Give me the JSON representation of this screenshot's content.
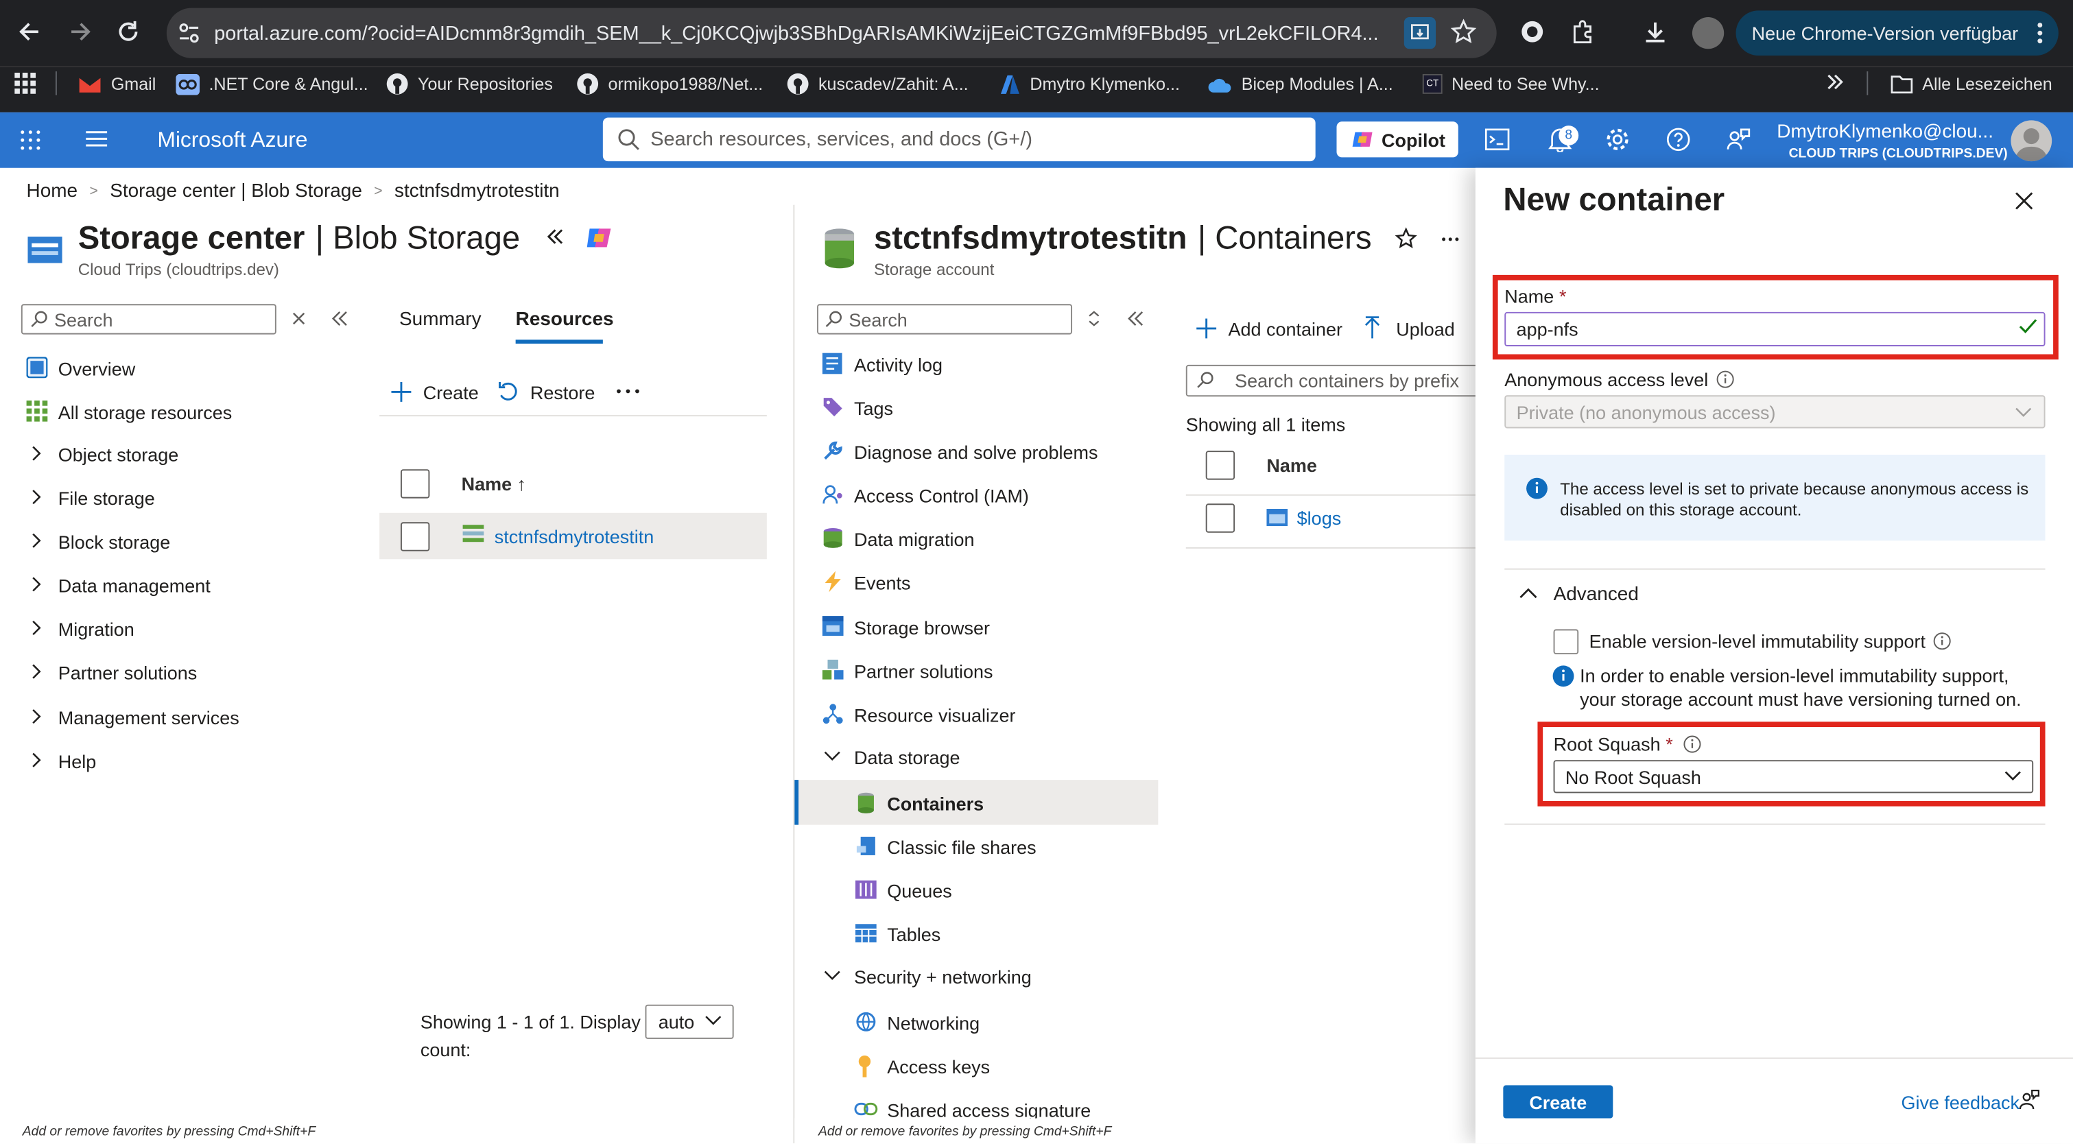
{
  "browser": {
    "url": "portal.azure.com/?ocid=AIDcmm8r3gmdih_SEM__k_Cj0KCQjwjb3SBhDgARIsAMKiWzijEeiCTGZGmMf9FBbd95_vrL2ekCFILOR4...",
    "update_label": "Neue Chrome-Version verfügbar",
    "bookmarks": [
      "Gmail",
      ".NET Core & Angul...",
      "Your Repositories",
      "ormikopo1988/Net...",
      "kuscadev/Zahit: A...",
      "Dmytro Klymenko...",
      "Bicep Modules | A...",
      "Need to See Why..."
    ],
    "all_bookmarks": "Alle Lesezeichen"
  },
  "azure": {
    "brand": "Microsoft Azure",
    "search_placeholder": "Search resources, services, and docs (G+/)",
    "copilot": "Copilot",
    "notification_count": "8",
    "user": "DmytroKlymenko@clou...",
    "tenant": "CLOUD TRIPS (CLOUDTRIPS.DEV)"
  },
  "breadcrumb": [
    "Home",
    "Storage center | Blob Storage",
    "stctnfsdmytrotestitn"
  ],
  "storage_center": {
    "title": "Storage center",
    "title_suffix": "| Blob Storage",
    "subtitle": "Cloud Trips (cloudtrips.dev)",
    "search_placeholder": "Search",
    "nav": [
      "Overview",
      "All storage resources",
      "Object storage",
      "File storage",
      "Block storage",
      "Data management",
      "Migration",
      "Partner solutions",
      "Management services",
      "Help"
    ],
    "favorites_hint": "Add or remove favorites by pressing Cmd+Shift+F"
  },
  "resources": {
    "tabs": [
      "Summary",
      "Resources"
    ],
    "active_tab": "Resources",
    "create": "Create",
    "restore": "Restore",
    "column_name": "Name ↑",
    "rows": [
      "stctnfsdmytrotestitn"
    ],
    "showing": "Showing 1 - 1 of 1. Display",
    "count_label": "count:",
    "display_value": "auto"
  },
  "account": {
    "title": "stctnfsdmytrotestitn",
    "title_suffix": "| Containers",
    "subtitle": "Storage account",
    "search_placeholder": "Search",
    "menu": [
      "Activity log",
      "Tags",
      "Diagnose and solve problems",
      "Access Control (IAM)",
      "Data migration",
      "Events",
      "Storage browser",
      "Partner solutions",
      "Resource visualizer"
    ],
    "data_storage_group": "Data storage",
    "data_storage_items": [
      "Containers",
      "Classic file shares",
      "Queues",
      "Tables"
    ],
    "security_group": "Security + networking",
    "security_items": [
      "Networking",
      "Access keys",
      "Shared access signature"
    ],
    "favorites_hint": "Add or remove favorites by pressing Cmd+Shift+F"
  },
  "containers": {
    "add_container": "Add container",
    "upload": "Upload",
    "search_placeholder": "Search containers by prefix",
    "showing": "Showing all 1 items",
    "column_name": "Name",
    "rows": [
      "$logs"
    ]
  },
  "new_container": {
    "title": "New container",
    "name_label": "Name",
    "name_value": "app-nfs",
    "access_label": "Anonymous access level",
    "access_value": "Private (no anonymous access)",
    "info_text": "The access level is set to private because anonymous access is disabled on this storage account.",
    "advanced": "Advanced",
    "immutability_label": "Enable version-level immutability support",
    "immutability_info": "In order to enable version-level immutability support, your storage account must have versioning turned on.",
    "root_squash_label": "Root Squash",
    "root_squash_value": "No Root Squash",
    "create_button": "Create",
    "feedback": "Give feedback"
  },
  "colors": {
    "azure_blue": "#2b74ce",
    "link": "#0f6cbd",
    "highlight_red": "#e1261c",
    "info_bg": "#ebf3fc"
  }
}
